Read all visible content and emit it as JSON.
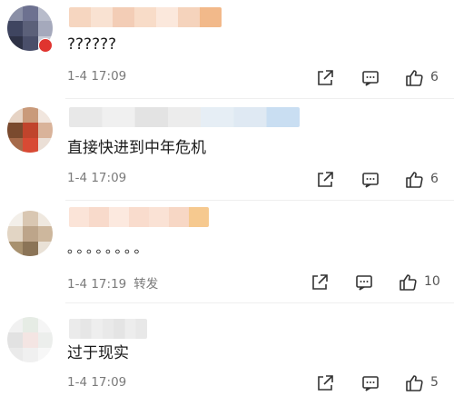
{
  "comments": [
    {
      "text": "??????",
      "time": "1-4 17:09",
      "repost_label": "",
      "likes": "6",
      "avatar_colors": [
        "#8a8fa6",
        "#6d7190",
        "#b8bccb",
        "#3f4560",
        "#5b6079",
        "#a5a9bc",
        "#2e3246",
        "#4a4f6a",
        "#c9cbd6"
      ],
      "username_colors": [
        "#f6d6c0",
        "#f9e2d2",
        "#f3cdb6",
        "#f8dcc8",
        "#fbe8dc",
        "#f5d3bc",
        "#f2b98a"
      ]
    },
    {
      "text": "直接快进到中年危机",
      "time": "1-4 17:09",
      "repost_label": "",
      "likes": "6",
      "avatar_colors": [
        "#e6d3c4",
        "#c99a7a",
        "#f1e6de",
        "#7a4a2e",
        "#c0442c",
        "#d9b39a",
        "#a66a4a",
        "#d84a34",
        "#ebdfd6"
      ],
      "username_colors": [
        "#e8e8e8",
        "#f0f0f0",
        "#e3e3e3",
        "#ececec",
        "#e6eef5",
        "#dfe9f3",
        "#c9def2"
      ]
    },
    {
      "text": "。。。。。。。。",
      "time": "1-4 17:19",
      "repost_label": "转发",
      "likes": "10",
      "avatar_colors": [
        "#f3efe9",
        "#d9c7b2",
        "#efe8df",
        "#e2d5c4",
        "#bda58a",
        "#cdb79d",
        "#a8916f",
        "#8b7457",
        "#e9e1d6"
      ],
      "username_colors": [
        "#fbe4d8",
        "#f8dacb",
        "#fce9df",
        "#f9dccd",
        "#fae2d5",
        "#f7d7c5",
        "#f6c98f"
      ]
    },
    {
      "text": "过于现实",
      "time": "1-4 17:09",
      "repost_label": "",
      "likes": "5",
      "avatar_colors": [
        "#f1f1f1",
        "#e6ece5",
        "#f5f5f5",
        "#e2e2e2",
        "#f4e5e3",
        "#eceeec",
        "#eaeaea",
        "#f0f0f0",
        "#f7f7f7"
      ],
      "username_colors": [
        "#ebebeb",
        "#e6e6e6",
        "#eeeeee",
        "#e9e9e9",
        "#e4e4e4",
        "#ededed",
        "#e8e8e8"
      ]
    }
  ],
  "icons": {
    "repost": "share-icon",
    "comment": "comment-icon",
    "like": "thumbs-up-icon"
  }
}
